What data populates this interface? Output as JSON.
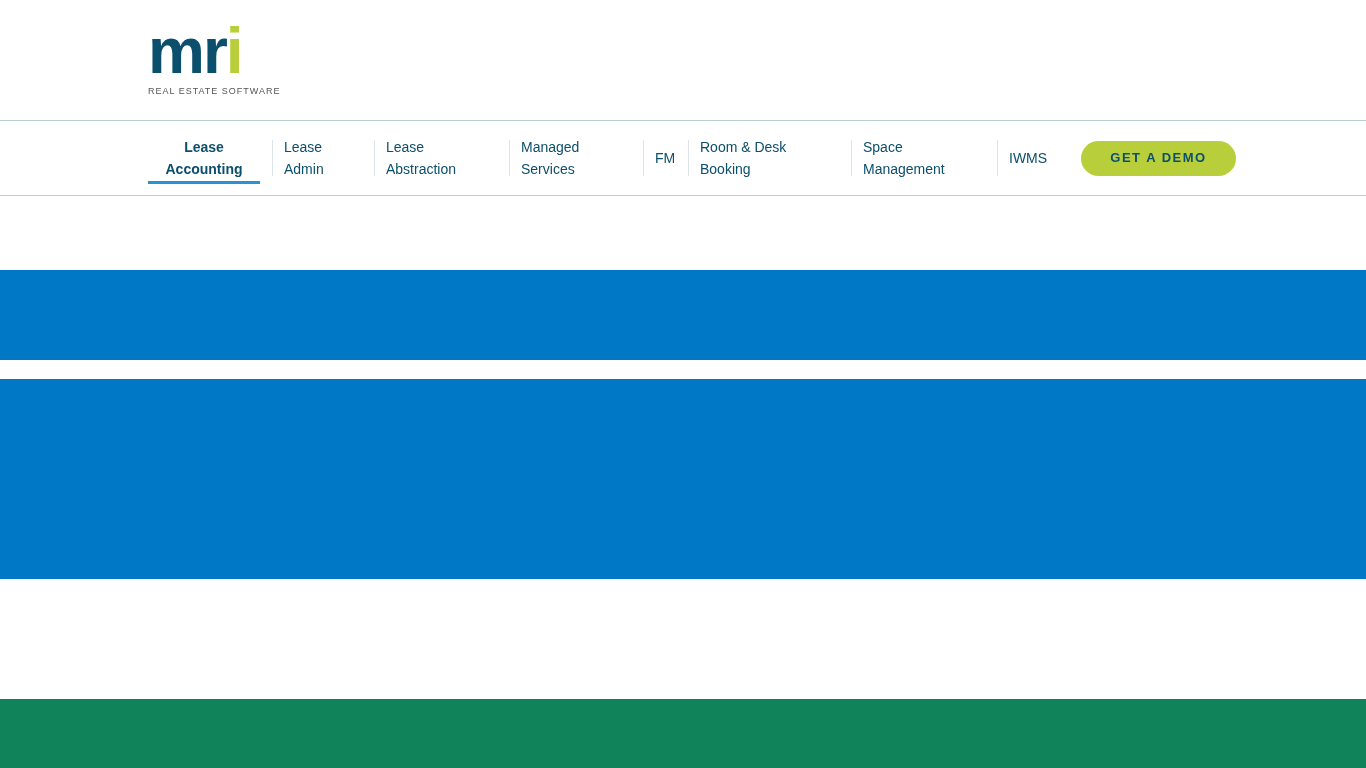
{
  "logo": {
    "mark": "mri",
    "tagline": "REAL ESTATE SOFTWARE"
  },
  "nav": [
    {
      "label": "Lease Accounting",
      "selected": true
    },
    {
      "label": "Lease Admin",
      "selected": false
    },
    {
      "label": "Lease Abstraction",
      "selected": false
    },
    {
      "label": "Managed Services",
      "selected": false
    },
    {
      "label": "FM",
      "selected": false
    },
    {
      "label": "Room & Desk Booking",
      "selected": false
    },
    {
      "label": "Space Management",
      "selected": false
    },
    {
      "label": "IWMS",
      "selected": false
    }
  ],
  "cta": "GET A DEMO"
}
